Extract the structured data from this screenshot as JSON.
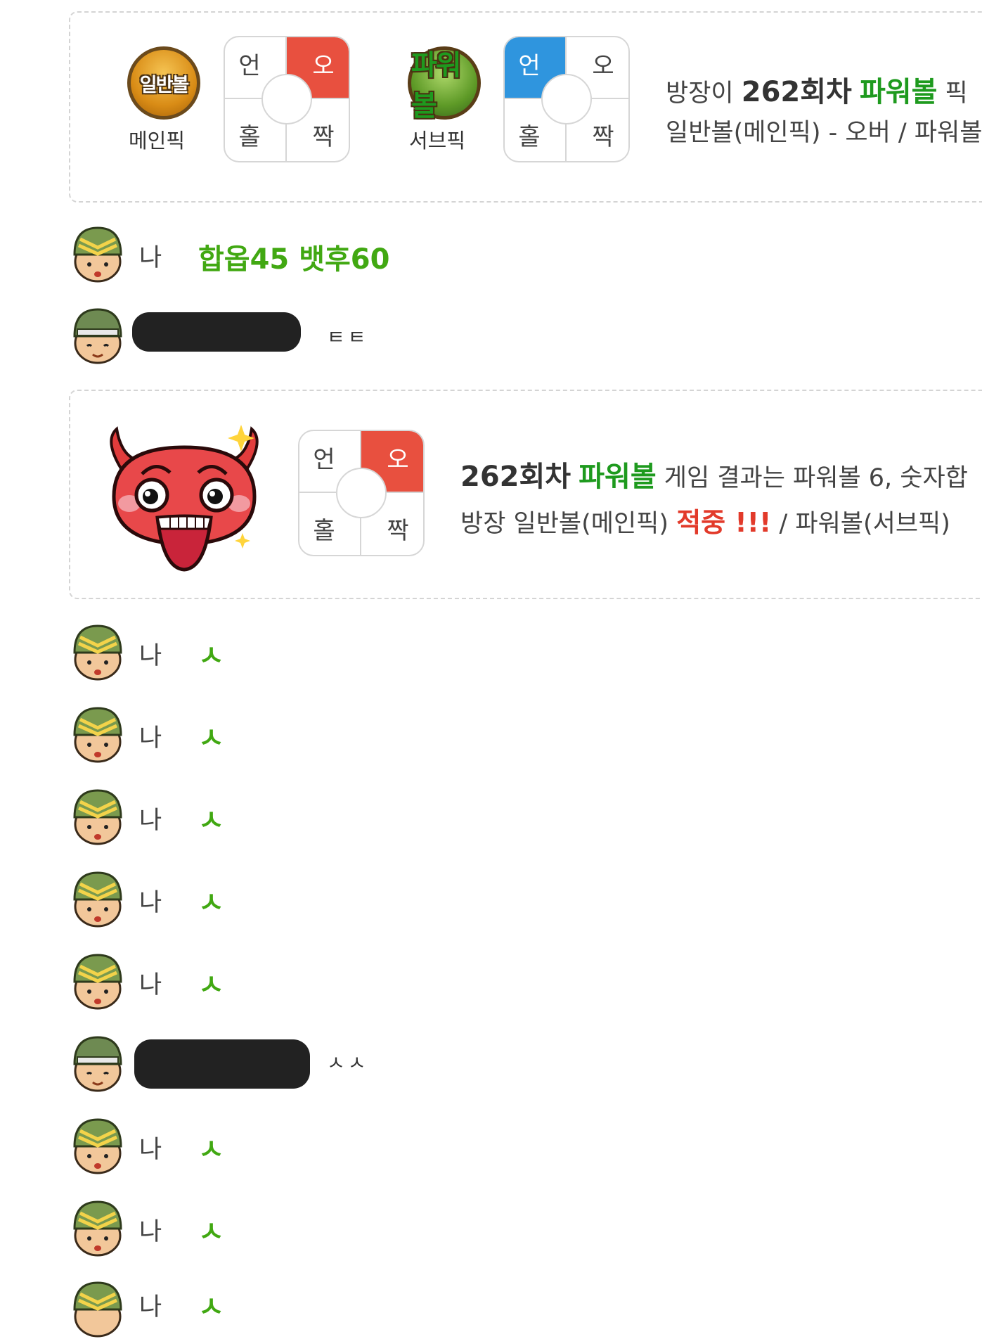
{
  "pick_panel": {
    "main_ball_label": "일반볼",
    "main_caption": "메인픽",
    "sub_ball_label": "파워볼",
    "sub_caption": "서브픽",
    "main_grid": {
      "tl": "언",
      "tr": "오",
      "bl": "홀",
      "br": "짝",
      "selected": "오"
    },
    "sub_grid": {
      "tl": "언",
      "tr": "오",
      "bl": "홀",
      "br": "짝",
      "selected": "언"
    },
    "line1_prefix": "방장이 ",
    "line1_round": "262회차",
    "line1_game": "파워볼",
    "line1_suffix": "픽",
    "line2": "일반볼(메인픽) - 오버 / 파워볼"
  },
  "result_panel": {
    "grid": {
      "tl": "언",
      "tr": "오",
      "bl": "홀",
      "br": "짝",
      "selected": "오"
    },
    "line1_round": "262회차",
    "line1_game": "파워볼",
    "line1_rest": "게임 결과는 파워볼 6, 숫자합",
    "line2_prefix": "방장 일반볼(메인픽)",
    "line2_hit": "적중 !!!",
    "line2_suffix": "/ 파워볼(서브픽)"
  },
  "chat": [
    {
      "nick": "나",
      "text": "합옵45 뱃후60"
    },
    {
      "nick": "",
      "text": "ㅌㅌ"
    },
    {
      "nick": "나",
      "text": "ㅅ"
    },
    {
      "nick": "나",
      "text": "ㅅ"
    },
    {
      "nick": "나",
      "text": "ㅅ"
    },
    {
      "nick": "나",
      "text": "ㅅ"
    },
    {
      "nick": "나",
      "text": "ㅅ"
    },
    {
      "nick": "",
      "text": "ㅅㅅ"
    },
    {
      "nick": "나",
      "text": "ㅅ"
    },
    {
      "nick": "나",
      "text": "ㅅ"
    },
    {
      "nick": "나",
      "text": "ㅅ"
    }
  ],
  "colors": {
    "green_text": "#1e9a1e",
    "chat_green": "#41a812",
    "pick_red": "#e8503f",
    "pick_blue": "#2f95de",
    "hit_red": "#e23a2a"
  },
  "icons": {
    "avatar_rank": "sergeant-helmet-avatar",
    "avatar_private": "private-helmet-avatar",
    "result": "red-devil-emoticon"
  }
}
